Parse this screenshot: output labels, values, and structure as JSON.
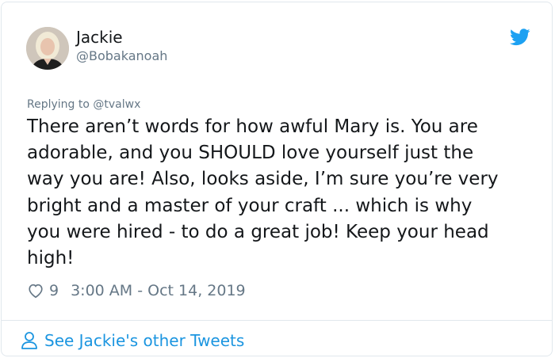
{
  "author": {
    "name": "Jackie",
    "handle": "@Bobakanoah",
    "avatar_icon": "profile-photo"
  },
  "reply_context": {
    "prefix": "Replying to",
    "mention": "@tvalwx"
  },
  "tweet": {
    "text": "There aren’t words for how awful Mary is. You are\nadorable, and you SHOULD love yourself just the\nway you are! Also, looks aside, I’m sure you’re very\nbright and a master of your craft ... which is why\nyou were hired - to do a great job! Keep your head\nhigh!",
    "likes": "9",
    "timestamp": "3:00 AM - Oct 14, 2019"
  },
  "footer": {
    "link_text": "See Jackie's other Tweets"
  },
  "icons": {
    "brand": "twitter-bird-icon",
    "like": "heart-icon",
    "footer": "person-icon"
  },
  "colors": {
    "brand": "#1da1f2",
    "link": "#1b95e0",
    "text": "#14171a",
    "secondary": "#657786",
    "border": "#e1e8ed"
  }
}
